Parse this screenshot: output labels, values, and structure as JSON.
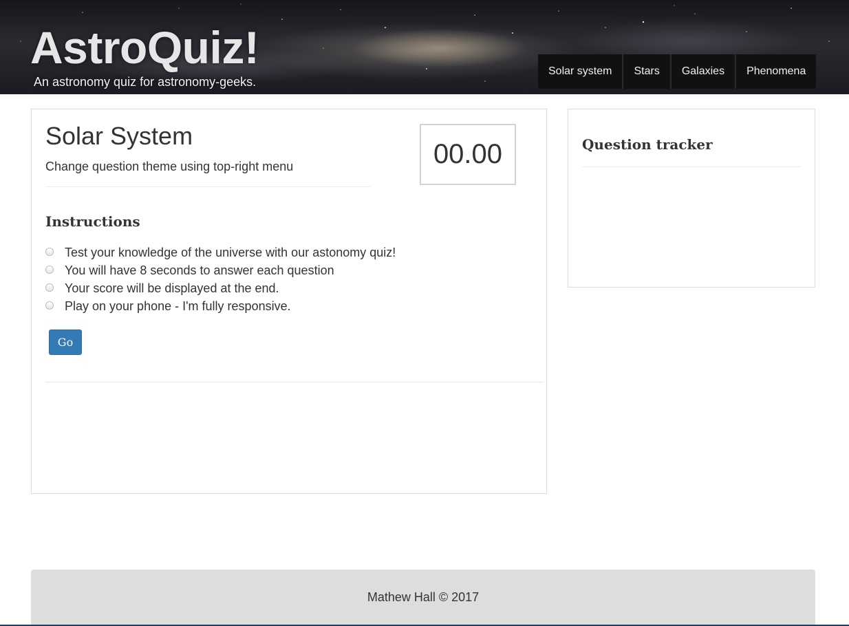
{
  "header": {
    "title": "AstroQuiz!",
    "subtitle": "An astronomy quiz for astronomy-geeks."
  },
  "nav": {
    "items": [
      {
        "label": "Solar system"
      },
      {
        "label": "Stars"
      },
      {
        "label": "Galaxies"
      },
      {
        "label": "Phenomena"
      }
    ]
  },
  "quiz": {
    "theme_title": "Solar System",
    "theme_hint": "Change question theme using top-right menu",
    "timer": "00.00",
    "instructions_heading": "Instructions",
    "instructions": [
      "Test your knowledge of the universe with our astonomy quiz!",
      "You will have 8 seconds to answer each question",
      "Your score will be displayed at the end.",
      "Play on your phone - I'm fully responsive."
    ],
    "go_label": "Go"
  },
  "tracker": {
    "heading": "Question tracker"
  },
  "footer": {
    "text": "Mathew Hall © 2017"
  },
  "colors": {
    "primary_button": "#337ab7",
    "nav_background": "#111111",
    "footer_background": "#dddddd"
  }
}
